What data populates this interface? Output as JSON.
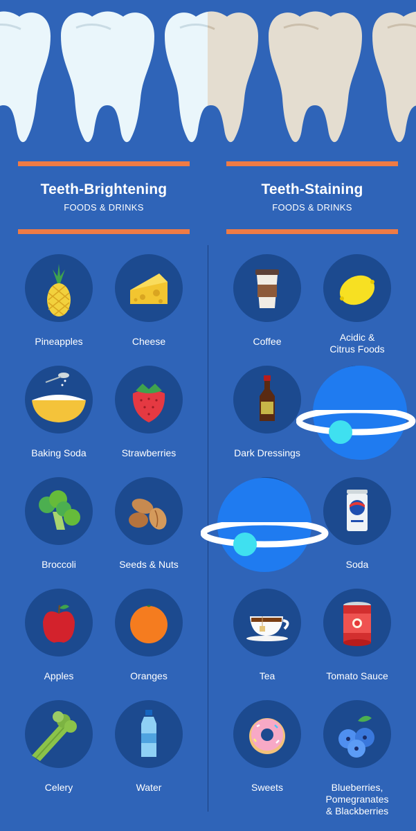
{
  "left_column": {
    "title": "Teeth-Brightening",
    "subtitle": "FOODS & DRINKS",
    "items": [
      {
        "label": "Pineapples",
        "icon": "pineapple-icon"
      },
      {
        "label": "Cheese",
        "icon": "cheese-icon"
      },
      {
        "label": "Baking Soda",
        "icon": "baking-soda-icon"
      },
      {
        "label": "Strawberries",
        "icon": "strawberry-icon"
      },
      {
        "label": "Broccoli",
        "icon": "broccoli-icon"
      },
      {
        "label": "Seeds & Nuts",
        "icon": "nuts-icon"
      },
      {
        "label": "Apples",
        "icon": "apple-icon"
      },
      {
        "label": "Oranges",
        "icon": "orange-icon"
      },
      {
        "label": "Celery",
        "icon": "celery-icon"
      },
      {
        "label": "Water",
        "icon": "water-bottle-icon"
      }
    ]
  },
  "right_column": {
    "title": "Teeth-Staining",
    "subtitle": "FOODS & DRINKS",
    "items": [
      {
        "label": "Coffee",
        "icon": "coffee-cup-icon"
      },
      {
        "label": "Acidic &\nCitrus Foods",
        "icon": "lemon-icon"
      },
      {
        "label": "Dark Dressings",
        "icon": "dressing-bottle-icon"
      },
      {
        "label": "",
        "icon": "hidden-item-icon"
      },
      {
        "label": "",
        "icon": "hidden-item-icon"
      },
      {
        "label": "Soda",
        "icon": "soda-can-icon"
      },
      {
        "label": "Tea",
        "icon": "tea-cup-icon"
      },
      {
        "label": "Tomato Sauce",
        "icon": "tomato-sauce-can-icon"
      },
      {
        "label": "Sweets",
        "icon": "donut-icon"
      },
      {
        "label": "Blueberries,\nPomegranates\n& Blackberries",
        "icon": "berries-icon"
      }
    ]
  },
  "colors": {
    "background": "#2f64b8",
    "circle": "#1c4a8f",
    "accent_bar": "#ef7b45",
    "white_tooth": "#eaf6fb",
    "stained_tooth": "#e4ddd0"
  }
}
